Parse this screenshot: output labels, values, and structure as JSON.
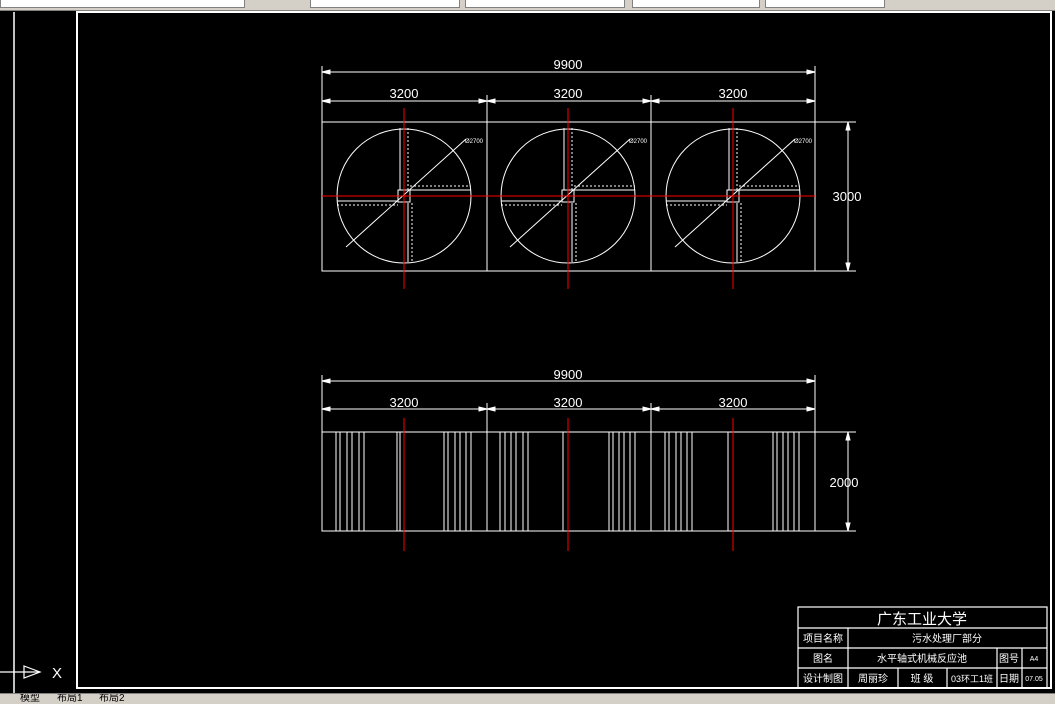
{
  "toolbar": {
    "fields": [
      "",
      "",
      "",
      "",
      ""
    ]
  },
  "tabs": {
    "model": "模型",
    "layout1": "布局1",
    "layout2": "布局2"
  },
  "plan_view": {
    "overall_dim": "9900",
    "segment_dims": [
      "3200",
      "3200",
      "3200"
    ],
    "height_dim": "3000",
    "diameter_label": "Ø2700"
  },
  "elevation_view": {
    "overall_dim": "9900",
    "segment_dims": [
      "3200",
      "3200",
      "3200"
    ],
    "height_dim": "2000"
  },
  "title_block": {
    "university": "广东工业大学",
    "project_label": "项目名称",
    "project_value": "污水处理厂部分",
    "drawing_label": "图名",
    "drawing_value": "水平轴式机械反应池",
    "drawing_no_label": "图号",
    "drawing_no_value": "A4",
    "designer_label": "设计制图",
    "designer_value": "周丽珍",
    "class_label": "班  级",
    "class_value": "03环工1班",
    "date_label": "日期",
    "date_value": "07.05"
  },
  "ucs": {
    "x_label": "X"
  },
  "colors": {
    "background": "#000000",
    "lines": "#ffffff",
    "centerlines": "#ff0000"
  }
}
